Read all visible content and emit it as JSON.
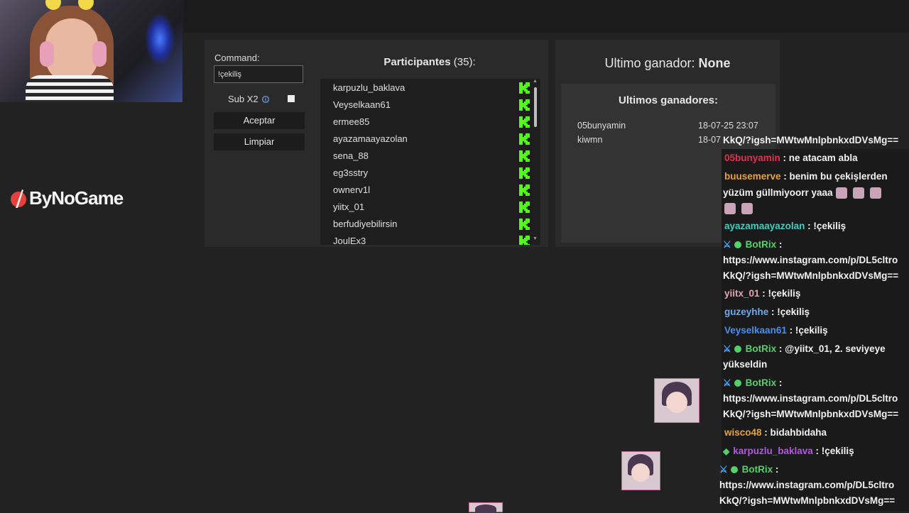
{
  "brand": {
    "name": "ByNoGame",
    "accent": "#e5413a"
  },
  "giveaway": {
    "command_label": "Command:",
    "command_value": "!çekiliş",
    "sub_label": "Sub X2",
    "accept_label": "Aceptar",
    "clear_label": "Limpiar",
    "participants_title": "Participantes",
    "participants_count": "(35):",
    "participants": [
      "karpuzlu_baklava",
      "Veyselkaan61",
      "ermee85",
      "ayazamaayazolan",
      "sena_88",
      "eg3sstry",
      "ownerv1l",
      "yiitx_01",
      "berfudiyebilirsin",
      "JoulEx3"
    ],
    "platform_icon": "kick-icon",
    "platform_color": "#53fc18"
  },
  "winners": {
    "last_label": "Ultimo ganador:",
    "last_value": "None",
    "history_title": "Ultimos ganadores:",
    "history": [
      {
        "name": "05bunyamin",
        "date": "18-07-25 23:07"
      },
      {
        "name": "kiwmn",
        "date": "18-07"
      }
    ]
  },
  "chat": {
    "messages": [
      {
        "user": "",
        "color": "#f2f2f2",
        "text": "KkQ/?igsh=MWtwMnlpbnkxdDVsMg=="
      },
      {
        "user": "05bunyamin",
        "color": "#e0304e",
        "text": " : ne atacam abla"
      },
      {
        "user": "buusemerve",
        "color": "#e6a23c",
        "text": " : benim bu çekişlerden"
      },
      {
        "user": "",
        "color": "#f2f2f2",
        "text": "yüzüm güllmiyoorr yaaa"
      },
      {
        "user": "ayazamaayazolan",
        "color": "#3fcfbf",
        "text": " : !çekiliş"
      },
      {
        "user": "BotRix",
        "color": "#53d16b",
        "text": " :"
      },
      {
        "user": "",
        "color": "#f2f2f2",
        "text": "https://www.instagram.com/p/DL5cltro"
      },
      {
        "user": "",
        "color": "#f2f2f2",
        "text": "KkQ/?igsh=MWtwMnlpbnkxdDVsMg=="
      },
      {
        "user": "yiitx_01",
        "color": "#e0a6b2",
        "text": " : !çekiliş"
      },
      {
        "user": "guzeyhhe",
        "color": "#6fa8f0",
        "text": " : !çekiliş"
      },
      {
        "user": "Veyselkaan61",
        "color": "#4a8ef0",
        "text": " : !çekiliş"
      },
      {
        "user": "BotRix",
        "color": "#53d16b",
        "text": " : @yiitx_01, 2. seviyeye"
      },
      {
        "user": "",
        "color": "#f2f2f2",
        "text": "yükseldin"
      },
      {
        "user": "BotRix",
        "color": "#53d16b",
        "text": " :"
      },
      {
        "user": "",
        "color": "#f2f2f2",
        "text": "https://www.instagram.com/p/DL5cltro"
      },
      {
        "user": "",
        "color": "#f2f2f2",
        "text": "KkQ/?igsh=MWtwMnlpbnkxdDVsMg=="
      },
      {
        "user": "wisco48",
        "color": "#e6a23c",
        "text": " : bidahbidaha"
      },
      {
        "user": "karpuzlu_baklava",
        "color": "#b455e8",
        "text": " : !çekiliş"
      },
      {
        "user": "BotRix",
        "color": "#53d16b",
        "text": " :"
      },
      {
        "user": "",
        "color": "#f2f2f2",
        "text": "https://www.instagram.com/p/DL5cltro"
      },
      {
        "user": "",
        "color": "#f2f2f2",
        "text": "KkQ/?igsh=MWtwMnlpbnkxdDVsMg=="
      }
    ]
  }
}
